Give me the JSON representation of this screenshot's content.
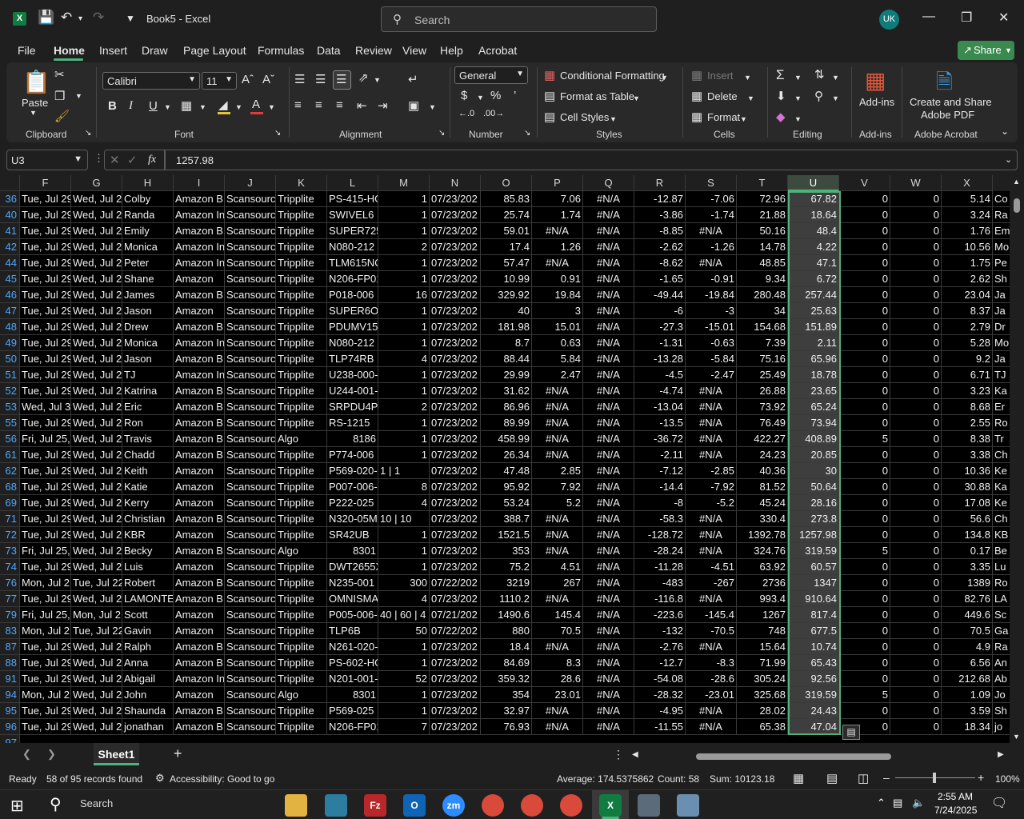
{
  "titlebar": {
    "app_icon": "X",
    "doc_title": "Book5  -  Excel",
    "search_placeholder": "Search",
    "avatar_initials": "UK"
  },
  "menu": {
    "tabs": [
      "File",
      "Home",
      "Insert",
      "Draw",
      "Page Layout",
      "Formulas",
      "Data",
      "Review",
      "View",
      "Help",
      "Acrobat"
    ],
    "share": "Share"
  },
  "ribbon": {
    "clipboard": {
      "paste": "Paste",
      "label": "Clipboard"
    },
    "font": {
      "name": "Calibri",
      "size": "11",
      "label": "Font",
      "bold": "B",
      "italic": "I",
      "underline": "U"
    },
    "alignment": {
      "label": "Alignment"
    },
    "number": {
      "format": "General",
      "label": "Number"
    },
    "styles": {
      "conditional": "Conditional Formatting",
      "format_table": "Format as Table",
      "cell_styles": "Cell Styles",
      "label": "Styles"
    },
    "cells": {
      "insert": "Insert",
      "delete": "Delete",
      "format": "Format",
      "label": "Cells"
    },
    "editing": {
      "label": "Editing"
    },
    "addins": {
      "button": "Add-ins",
      "label": "Add-ins"
    },
    "acrobat": {
      "line1": "Create and Share",
      "line2": "Adobe PDF",
      "label": "Adobe Acrobat"
    }
  },
  "formula_bar": {
    "cell": "U3",
    "fx": "fx",
    "value": "1257.98"
  },
  "grid": {
    "selected_column": "U",
    "columns": [
      "F",
      "G",
      "H",
      "I",
      "J",
      "K",
      "L",
      "M",
      "N",
      "O",
      "P",
      "Q",
      "R",
      "S",
      "T",
      "U",
      "V",
      "W",
      "X"
    ],
    "rows": [
      {
        "n": "36",
        "F": "Tue, Jul 29",
        "G": "Wed, Jul 2",
        "H": "Colby",
        "I": "Amazon B",
        "J": "Scansourc",
        "K": "Tripplite",
        "L": "PS-415-HG",
        "M": "1",
        "N": "07/23/202",
        "O": "85.83",
        "P": "7.06",
        "Q": "#N/A",
        "R": "-12.87",
        "S": "-7.06",
        "T": "72.96",
        "U": "67.82",
        "V": "0",
        "W": "0",
        "X": "5.14",
        "Y": "Co"
      },
      {
        "n": "40",
        "F": "Tue, Jul 29",
        "G": "Wed, Jul 2",
        "H": "Randa",
        "I": "Amazon In",
        "J": "Scansourc",
        "K": "Tripplite",
        "L": "SWIVEL6",
        "M": "1",
        "N": "07/23/202",
        "O": "25.74",
        "P": "1.74",
        "Q": "#N/A",
        "R": "-3.86",
        "S": "-1.74",
        "T": "21.88",
        "U": "18.64",
        "V": "0",
        "W": "0",
        "X": "3.24",
        "Y": "Ra"
      },
      {
        "n": "41",
        "F": "Tue, Jul 29",
        "G": "Wed, Jul 2",
        "H": "Emily",
        "I": "Amazon B",
        "J": "Scansourc",
        "K": "Tripplite",
        "L": "SUPER725",
        "M": "1",
        "N": "07/23/202",
        "O": "59.01",
        "P": "#N/A",
        "Q": "#N/A",
        "R": "-8.85",
        "S": "#N/A",
        "T": "50.16",
        "U": "48.4",
        "V": "0",
        "W": "0",
        "X": "1.76",
        "Y": "Em"
      },
      {
        "n": "42",
        "F": "Tue, Jul 29",
        "G": "Wed, Jul 2",
        "H": "Monica",
        "I": "Amazon In",
        "J": "Scansourc",
        "K": "Tripplite",
        "L": "N080-212",
        "M": "2",
        "N": "07/23/202",
        "O": "17.4",
        "P": "1.26",
        "Q": "#N/A",
        "R": "-2.62",
        "S": "-1.26",
        "T": "14.78",
        "U": "4.22",
        "V": "0",
        "W": "0",
        "X": "10.56",
        "Y": "Mo"
      },
      {
        "n": "44",
        "F": "Tue, Jul 29",
        "G": "Wed, Jul 2",
        "H": "Peter",
        "I": "Amazon In",
        "J": "Scansourc",
        "K": "Tripplite",
        "L": "TLM615NC",
        "M": "1",
        "N": "07/23/202",
        "O": "57.47",
        "P": "#N/A",
        "Q": "#N/A",
        "R": "-8.62",
        "S": "#N/A",
        "T": "48.85",
        "U": "47.1",
        "V": "0",
        "W": "0",
        "X": "1.75",
        "Y": "Pe"
      },
      {
        "n": "45",
        "F": "Tue, Jul 29",
        "G": "Wed, Jul 2",
        "H": "Shane",
        "I": "Amazon",
        "J": "Scansourc",
        "K": "Tripplite",
        "L": "N206-FP01",
        "M": "1",
        "N": "07/23/202",
        "O": "10.99",
        "P": "0.91",
        "Q": "#N/A",
        "R": "-1.65",
        "S": "-0.91",
        "T": "9.34",
        "U": "6.72",
        "V": "0",
        "W": "0",
        "X": "2.62",
        "Y": "Sh"
      },
      {
        "n": "46",
        "F": "Tue, Jul 29",
        "G": "Wed, Jul 2",
        "H": "James",
        "I": "Amazon B",
        "J": "Scansourc",
        "K": "Tripplite",
        "L": "P018-006",
        "M": "16",
        "N": "07/23/202",
        "O": "329.92",
        "P": "19.84",
        "Q": "#N/A",
        "R": "-49.44",
        "S": "-19.84",
        "T": "280.48",
        "U": "257.44",
        "V": "0",
        "W": "0",
        "X": "23.04",
        "Y": "Ja"
      },
      {
        "n": "47",
        "F": "Tue, Jul 29",
        "G": "Wed, Jul 2",
        "H": "Jason",
        "I": "Amazon",
        "J": "Scansourc",
        "K": "Tripplite",
        "L": "SUPER6OM",
        "M": "1",
        "N": "07/23/202",
        "O": "40",
        "P": "3",
        "Q": "#N/A",
        "R": "-6",
        "S": "-3",
        "T": "34",
        "U": "25.63",
        "V": "0",
        "W": "0",
        "X": "8.37",
        "Y": "Ja"
      },
      {
        "n": "48",
        "F": "Tue, Jul 29",
        "G": "Wed, Jul 2",
        "H": "Drew",
        "I": "Amazon B",
        "J": "Scansourc",
        "K": "Tripplite",
        "L": "PDUMV15",
        "M": "1",
        "N": "07/23/202",
        "O": "181.98",
        "P": "15.01",
        "Q": "#N/A",
        "R": "-27.3",
        "S": "-15.01",
        "T": "154.68",
        "U": "151.89",
        "V": "0",
        "W": "0",
        "X": "2.79",
        "Y": "Dr"
      },
      {
        "n": "49",
        "F": "Tue, Jul 29",
        "G": "Wed, Jul 2",
        "H": "Monica",
        "I": "Amazon In",
        "J": "Scansourc",
        "K": "Tripplite",
        "L": "N080-212",
        "M": "1",
        "N": "07/23/202",
        "O": "8.7",
        "P": "0.63",
        "Q": "#N/A",
        "R": "-1.31",
        "S": "-0.63",
        "T": "7.39",
        "U": "2.11",
        "V": "0",
        "W": "0",
        "X": "5.28",
        "Y": "Mo"
      },
      {
        "n": "50",
        "F": "Tue, Jul 29",
        "G": "Wed, Jul 2",
        "H": "Jason",
        "I": "Amazon B",
        "J": "Scansourc",
        "K": "Tripplite",
        "L": "TLP74RB",
        "M": "4",
        "N": "07/23/202",
        "O": "88.44",
        "P": "5.84",
        "Q": "#N/A",
        "R": "-13.28",
        "S": "-5.84",
        "T": "75.16",
        "U": "65.96",
        "V": "0",
        "W": "0",
        "X": "9.2",
        "Y": "Ja"
      },
      {
        "n": "51",
        "F": "Tue, Jul 29",
        "G": "Wed, Jul 2",
        "H": "TJ",
        "I": "Amazon In",
        "J": "Scansourc",
        "K": "Tripplite",
        "L": "U238-000-",
        "M": "1",
        "N": "07/23/202",
        "O": "29.99",
        "P": "2.47",
        "Q": "#N/A",
        "R": "-4.5",
        "S": "-2.47",
        "T": "25.49",
        "U": "18.78",
        "V": "0",
        "W": "0",
        "X": "6.71",
        "Y": "TJ"
      },
      {
        "n": "52",
        "F": "Tue, Jul 29",
        "G": "Wed, Jul 2",
        "H": "Katrina",
        "I": "Amazon B",
        "J": "Scansourc",
        "K": "Tripplite",
        "L": "U244-001-",
        "M": "1",
        "N": "07/23/202",
        "O": "31.62",
        "P": "#N/A",
        "Q": "#N/A",
        "R": "-4.74",
        "S": "#N/A",
        "T": "26.88",
        "U": "23.65",
        "V": "0",
        "W": "0",
        "X": "3.23",
        "Y": "Ka"
      },
      {
        "n": "53",
        "F": "Wed, Jul 3",
        "G": "Wed, Jul 2",
        "H": "Eric",
        "I": "Amazon B",
        "J": "Scansourc",
        "K": "Tripplite",
        "L": "SRPDU4PH",
        "M": "2",
        "N": "07/23/202",
        "O": "86.96",
        "P": "#N/A",
        "Q": "#N/A",
        "R": "-13.04",
        "S": "#N/A",
        "T": "73.92",
        "U": "65.24",
        "V": "0",
        "W": "0",
        "X": "8.68",
        "Y": "Er"
      },
      {
        "n": "55",
        "F": "Tue, Jul 29",
        "G": "Wed, Jul 2",
        "H": "Ron",
        "I": "Amazon B",
        "J": "Scansourc",
        "K": "Tripplite",
        "L": "RS-1215",
        "M": "1",
        "N": "07/23/202",
        "O": "89.99",
        "P": "#N/A",
        "Q": "#N/A",
        "R": "-13.5",
        "S": "#N/A",
        "T": "76.49",
        "U": "73.94",
        "V": "0",
        "W": "0",
        "X": "2.55",
        "Y": "Ro"
      },
      {
        "n": "56",
        "F": "Fri, Jul 25,",
        "G": "Wed, Jul 2",
        "H": "Travis",
        "I": "Amazon B",
        "J": "Scansourc",
        "K": "Algo",
        "L": "8186",
        "M": "1",
        "N": "07/23/202",
        "O": "458.99",
        "P": "#N/A",
        "Q": "#N/A",
        "R": "-36.72",
        "S": "#N/A",
        "T": "422.27",
        "U": "408.89",
        "V": "5",
        "W": "0",
        "X": "8.38",
        "Y": "Tr"
      },
      {
        "n": "61",
        "F": "Tue, Jul 29",
        "G": "Wed, Jul 2",
        "H": "Chadd",
        "I": "Amazon B",
        "J": "Scansourc",
        "K": "Tripplite",
        "L": "P774-006",
        "M": "1",
        "N": "07/23/202",
        "O": "26.34",
        "P": "#N/A",
        "Q": "#N/A",
        "R": "-2.11",
        "S": "#N/A",
        "T": "24.23",
        "U": "20.85",
        "V": "0",
        "W": "0",
        "X": "3.38",
        "Y": "Ch"
      },
      {
        "n": "62",
        "F": "Tue, Jul 29",
        "G": "Wed, Jul 2",
        "H": "Keith",
        "I": "Amazon",
        "J": "Scansourc",
        "K": "Tripplite",
        "L": "P569-020-",
        "M": "1 | 1",
        "N": "07/23/202",
        "O": "47.48",
        "P": "2.85",
        "Q": "#N/A",
        "R": "-7.12",
        "S": "-2.85",
        "T": "40.36",
        "U": "30",
        "V": "0",
        "W": "0",
        "X": "10.36",
        "Y": "Ke"
      },
      {
        "n": "68",
        "F": "Tue, Jul 29",
        "G": "Wed, Jul 2",
        "H": "Katie",
        "I": "Amazon",
        "J": "Scansourc",
        "K": "Tripplite",
        "L": "P007-006-",
        "M": "8",
        "N": "07/23/202",
        "O": "95.92",
        "P": "7.92",
        "Q": "#N/A",
        "R": "-14.4",
        "S": "-7.92",
        "T": "81.52",
        "U": "50.64",
        "V": "0",
        "W": "0",
        "X": "30.88",
        "Y": "Ka"
      },
      {
        "n": "69",
        "F": "Tue, Jul 29",
        "G": "Wed, Jul 2",
        "H": "Kerry",
        "I": "Amazon",
        "J": "Scansourc",
        "K": "Tripplite",
        "L": "P222-025",
        "M": "4",
        "N": "07/23/202",
        "O": "53.24",
        "P": "5.2",
        "Q": "#N/A",
        "R": "-8",
        "S": "-5.2",
        "T": "45.24",
        "U": "28.16",
        "V": "0",
        "W": "0",
        "X": "17.08",
        "Y": "Ke"
      },
      {
        "n": "71",
        "F": "Tue, Jul 29",
        "G": "Wed, Jul 2",
        "H": "Christian",
        "I": "Amazon B",
        "J": "Scansourc",
        "K": "Tripplite",
        "L": "N320-05M",
        "M": "10 | 10",
        "N": "07/23/202",
        "O": "388.7",
        "P": "#N/A",
        "Q": "#N/A",
        "R": "-58.3",
        "S": "#N/A",
        "T": "330.4",
        "U": "273.8",
        "V": "0",
        "W": "0",
        "X": "56.6",
        "Y": "Ch"
      },
      {
        "n": "72",
        "F": "Tue, Jul 29",
        "G": "Wed, Jul 2",
        "H": "KBR",
        "I": "Amazon",
        "J": "Scansourc",
        "K": "Tripplite",
        "L": "SR42UB",
        "M": "1",
        "N": "07/23/202",
        "O": "1521.5",
        "P": "#N/A",
        "Q": "#N/A",
        "R": "-128.72",
        "S": "#N/A",
        "T": "1392.78",
        "U": "1257.98",
        "V": "0",
        "W": "0",
        "X": "134.8",
        "Y": "KB"
      },
      {
        "n": "73",
        "F": "Fri, Jul 25,",
        "G": "Wed, Jul 2",
        "H": "Becky",
        "I": "Amazon B",
        "J": "Scansourc",
        "K": "Algo",
        "L": "8301",
        "M": "1",
        "N": "07/23/202",
        "O": "353",
        "P": "#N/A",
        "Q": "#N/A",
        "R": "-28.24",
        "S": "#N/A",
        "T": "324.76",
        "U": "319.59",
        "V": "5",
        "W": "0",
        "X": "0.17",
        "Y": "Be"
      },
      {
        "n": "74",
        "F": "Tue, Jul 29",
        "G": "Wed, Jul 2",
        "H": "Luis",
        "I": "Amazon",
        "J": "Scansourc",
        "K": "Tripplite",
        "L": "DWT2655X",
        "M": "1",
        "N": "07/23/202",
        "O": "75.2",
        "P": "4.51",
        "Q": "#N/A",
        "R": "-11.28",
        "S": "-4.51",
        "T": "63.92",
        "U": "60.57",
        "V": "0",
        "W": "0",
        "X": "3.35",
        "Y": "Lu"
      },
      {
        "n": "76",
        "F": "Mon, Jul 2",
        "G": "Tue, Jul 22",
        "H": "Robert",
        "I": "Amazon B",
        "J": "Scansourc",
        "K": "Tripplite",
        "L": "N235-001",
        "M": "300",
        "N": "07/22/202",
        "O": "3219",
        "P": "267",
        "Q": "#N/A",
        "R": "-483",
        "S": "-267",
        "T": "2736",
        "U": "1347",
        "V": "0",
        "W": "0",
        "X": "1389",
        "Y": "Ro"
      },
      {
        "n": "77",
        "F": "Tue, Jul 29",
        "G": "Wed, Jul 2",
        "H": "LAMONTE",
        "I": "Amazon B",
        "J": "Scansourc",
        "K": "Tripplite",
        "L": "OMNISMA",
        "M": "4",
        "N": "07/23/202",
        "O": "1110.2",
        "P": "#N/A",
        "Q": "#N/A",
        "R": "-116.8",
        "S": "#N/A",
        "T": "993.4",
        "U": "910.64",
        "V": "0",
        "W": "0",
        "X": "82.76",
        "Y": "LA"
      },
      {
        "n": "79",
        "F": "Fri, Jul 25,",
        "G": "Mon, Jul 2",
        "H": "Scott",
        "I": "Amazon",
        "J": "Scansourc",
        "K": "Tripplite",
        "L": "P005-006-",
        "M": "40 | 60 | 4",
        "N": "07/21/202",
        "O": "1490.6",
        "P": "145.4",
        "Q": "#N/A",
        "R": "-223.6",
        "S": "-145.4",
        "T": "1267",
        "U": "817.4",
        "V": "0",
        "W": "0",
        "X": "449.6",
        "Y": "Sc"
      },
      {
        "n": "83",
        "F": "Mon, Jul 2",
        "G": "Tue, Jul 22",
        "H": "Gavin",
        "I": "Amazon",
        "J": "Scansourc",
        "K": "Tripplite",
        "L": "TLP6B",
        "M": "50",
        "N": "07/22/202",
        "O": "880",
        "P": "70.5",
        "Q": "#N/A",
        "R": "-132",
        "S": "-70.5",
        "T": "748",
        "U": "677.5",
        "V": "0",
        "W": "0",
        "X": "70.5",
        "Y": "Ga"
      },
      {
        "n": "87",
        "F": "Tue, Jul 29",
        "G": "Wed, Jul 2",
        "H": "Ralph",
        "I": "Amazon B",
        "J": "Scansourc",
        "K": "Tripplite",
        "L": "N261-020-",
        "M": "1",
        "N": "07/23/202",
        "O": "18.4",
        "P": "#N/A",
        "Q": "#N/A",
        "R": "-2.76",
        "S": "#N/A",
        "T": "15.64",
        "U": "10.74",
        "V": "0",
        "W": "0",
        "X": "4.9",
        "Y": "Ra"
      },
      {
        "n": "88",
        "F": "Tue, Jul 29",
        "G": "Wed, Jul 2",
        "H": "Anna",
        "I": "Amazon B",
        "J": "Scansourc",
        "K": "Tripplite",
        "L": "PS-602-HG",
        "M": "1",
        "N": "07/23/202",
        "O": "84.69",
        "P": "8.3",
        "Q": "#N/A",
        "R": "-12.7",
        "S": "-8.3",
        "T": "71.99",
        "U": "65.43",
        "V": "0",
        "W": "0",
        "X": "6.56",
        "Y": "An"
      },
      {
        "n": "91",
        "F": "Tue, Jul 29",
        "G": "Wed, Jul 2",
        "H": "Abigail",
        "I": "Amazon In",
        "J": "Scansourc",
        "K": "Tripplite",
        "L": "N201-001-",
        "M": "52",
        "N": "07/23/202",
        "O": "359.32",
        "P": "28.6",
        "Q": "#N/A",
        "R": "-54.08",
        "S": "-28.6",
        "T": "305.24",
        "U": "92.56",
        "V": "0",
        "W": "0",
        "X": "212.68",
        "Y": "Ab"
      },
      {
        "n": "94",
        "F": "Mon, Jul 2",
        "G": "Wed, Jul 2",
        "H": "John",
        "I": "Amazon",
        "J": "Scansourc",
        "K": "Algo",
        "L": "8301",
        "M": "1",
        "N": "07/23/202",
        "O": "354",
        "P": "23.01",
        "Q": "#N/A",
        "R": "-28.32",
        "S": "-23.01",
        "T": "325.68",
        "U": "319.59",
        "V": "5",
        "W": "0",
        "X": "1.09",
        "Y": "Jo"
      },
      {
        "n": "95",
        "F": "Tue, Jul 29",
        "G": "Wed, Jul 2",
        "H": "Shaunda",
        "I": "Amazon B",
        "J": "Scansourc",
        "K": "Tripplite",
        "L": "P569-025",
        "M": "1",
        "N": "07/23/202",
        "O": "32.97",
        "P": "#N/A",
        "Q": "#N/A",
        "R": "-4.95",
        "S": "#N/A",
        "T": "28.02",
        "U": "24.43",
        "V": "0",
        "W": "0",
        "X": "3.59",
        "Y": "Sh"
      },
      {
        "n": "96",
        "F": "Tue, Jul 29",
        "G": "Wed, Jul 2",
        "H": "jonathan",
        "I": "Amazon B",
        "J": "Scansourc",
        "K": "Tripplite",
        "L": "N206-FP01",
        "M": "7",
        "N": "07/23/202",
        "O": "76.93",
        "P": "#N/A",
        "Q": "#N/A",
        "R": "-11.55",
        "S": "#N/A",
        "T": "65.38",
        "U": "47.04",
        "V": "0",
        "W": "0",
        "X": "18.34",
        "Y": "jo"
      }
    ],
    "partial_row": "97"
  },
  "sheets": {
    "active": "Sheet1"
  },
  "status": {
    "ready": "Ready",
    "records": "58 of 95 records found",
    "accessibility": "Accessibility: Good to go",
    "average": "Average: 174.5375862",
    "count": "Count: 58",
    "sum": "Sum: 10123.18",
    "zoom": "100%"
  },
  "taskbar": {
    "search": "Search",
    "time": "2:55 AM",
    "date": "7/24/2025"
  }
}
